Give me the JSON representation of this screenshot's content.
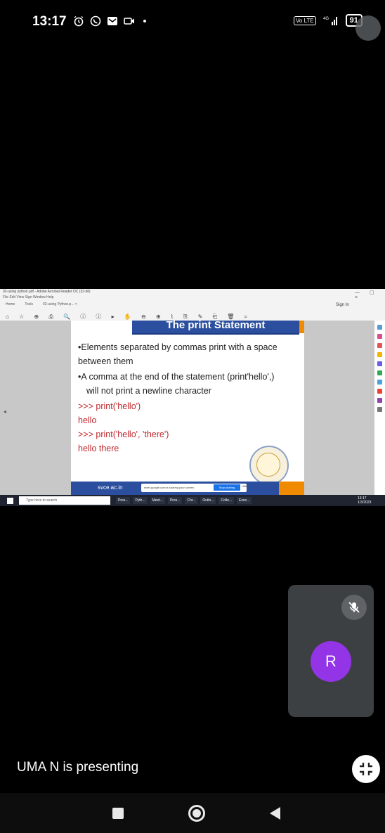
{
  "status_bar": {
    "time": "13:17",
    "network": "4G",
    "battery": "91",
    "volte": "Vo LTE"
  },
  "acrobat": {
    "title": "02-using python.pdf - Adobe Acrobat Reader DC (32-bit)",
    "menu": "File  Edit  View  Sign  Window  Help",
    "tabs": [
      "Home",
      "Tools",
      "02-using Python.p... ×"
    ],
    "tools": "⌂ ☆ ⊕ ⎙ 🔍 ⓘ ⓘ  ▸ ✋ ⊖ ⊕ ⌇ ⎘ ✎ ⎗ 🗑 ⌕",
    "sign_in": "Sign In",
    "window_controls": "— ▢ ×"
  },
  "slide": {
    "title": "The print Statement",
    "lines": [
      {
        "text": "•Elements separated by commas print with a space",
        "type": "normal"
      },
      {
        "text": "between them",
        "type": "normal"
      },
      {
        "text": "•A comma at the end of the statement (print'hello',)",
        "type": "normal"
      },
      {
        "text": "will not print a newline character",
        "type": "indent"
      },
      {
        "text": ">>> print('hello')",
        "type": "code"
      },
      {
        "text": "hello",
        "type": "code"
      },
      {
        "text": ">>> print('hello', 'there')",
        "type": "code"
      },
      {
        "text": "hello there",
        "type": "code"
      }
    ],
    "footer_left": "svce.ac.in",
    "share_text": "meet.google.com is sharing your screen.",
    "stop_sharing": "Stop sharing",
    "hide": "Hide"
  },
  "taskbar": {
    "search_placeholder": "Type here to search",
    "apps": [
      "Pres...",
      "Pyth...",
      "Meet...",
      "Pres...",
      "Chr...",
      "Outlo...",
      "Colle...",
      "Exce..."
    ],
    "time": "13:17",
    "date": "1/3/2023"
  },
  "self_tile": {
    "initial": "R",
    "avatar_color": "#9334e6"
  },
  "presenting_text": "UMA N is presenting"
}
